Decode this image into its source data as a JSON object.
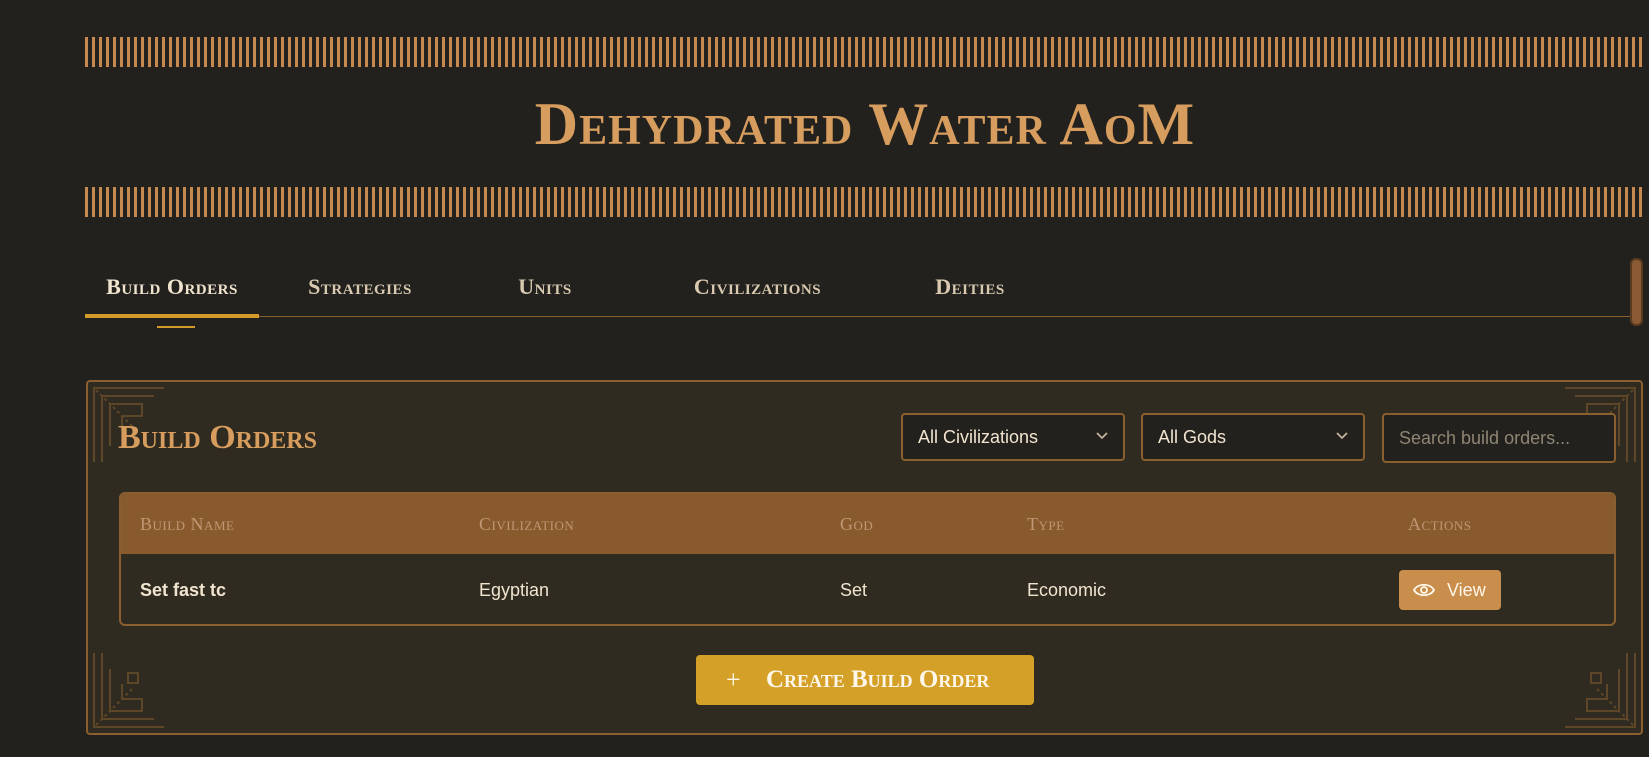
{
  "site": {
    "title": "Dehydrated Water AoM"
  },
  "nav": {
    "tabs": [
      {
        "label": "Build Orders",
        "active": true
      },
      {
        "label": "Strategies"
      },
      {
        "label": "Units"
      },
      {
        "label": "Civilizations"
      },
      {
        "label": "Deities"
      }
    ]
  },
  "panel": {
    "title": "Build Orders",
    "filters": {
      "civilization": {
        "selected": "All Civilizations"
      },
      "god": {
        "selected": "All Gods"
      },
      "search": {
        "value": "",
        "placeholder": "Search build orders..."
      }
    },
    "table": {
      "headers": [
        "Build Name",
        "Civilization",
        "God",
        "Type",
        "Actions"
      ],
      "rows": [
        {
          "name": "Set fast tc",
          "civilization": "Egyptian",
          "god": "Set",
          "type": "Economic",
          "action": "View"
        }
      ]
    },
    "create_button": {
      "icon": "plus-icon",
      "label": "Create Build Order"
    }
  },
  "colors": {
    "background": "#22211d",
    "panel": "#302b21",
    "accent_bronze": "#d79d5e",
    "gold": "#d4a028",
    "table_header": "#8a5a2f",
    "border": "#8a5f30"
  }
}
